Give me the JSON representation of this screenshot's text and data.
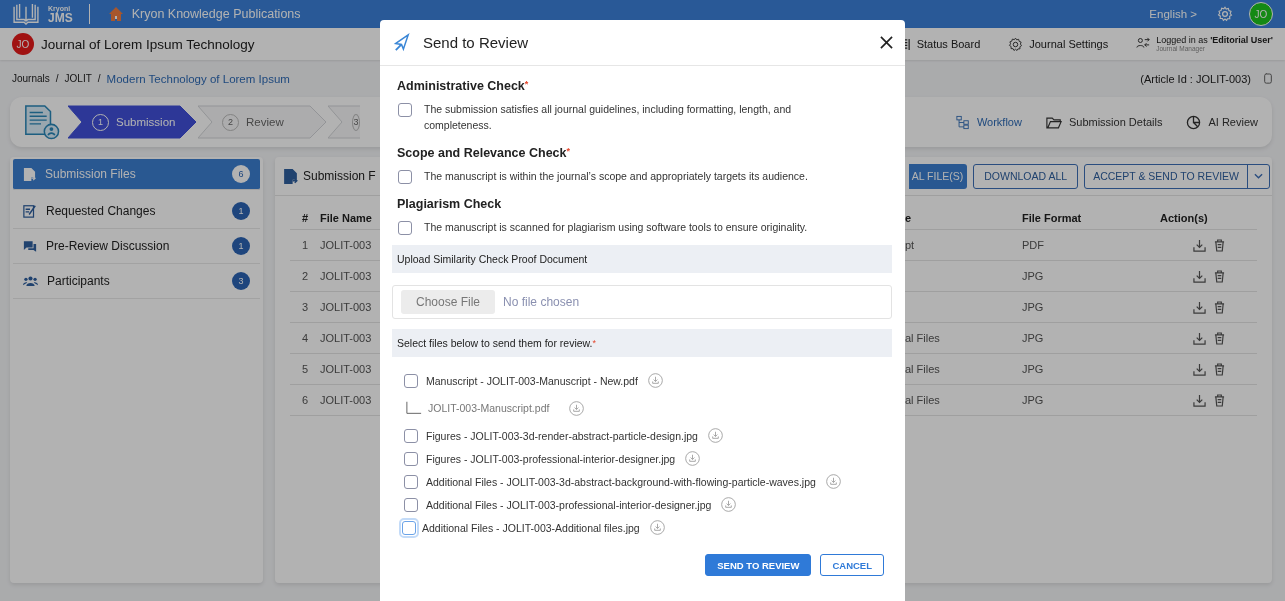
{
  "header": {
    "brand_small": "Kryoni",
    "brand": "JMS",
    "publisher": "Kryon Knowledge Publications",
    "language": "English >",
    "user_initials": "JO"
  },
  "journal_bar": {
    "initials": "JO",
    "journal": "Journal of Lorem Ipsum Technology",
    "links": [
      {
        "label": "Status Board",
        "kind": "board"
      },
      {
        "label": "Journal Settings",
        "kind": "settings"
      }
    ],
    "login": "Logged in as **'Editorial User'**",
    "role": "Journal Manager"
  },
  "breadcrumb": {
    "separator": "/",
    "items": [
      {
        "label": "Journals",
        "current": false
      },
      {
        "label": "JOLIT",
        "current": false
      },
      {
        "label": "Modern Technology of Lorem Ipsum",
        "current": true
      }
    ],
    "article_id": "(Article Id : JOLIT-003)"
  },
  "stepper": {
    "steps": [
      {
        "number": "1",
        "label": "Submission",
        "selected": true
      },
      {
        "number": "2",
        "label": "Review",
        "selected": false
      },
      {
        "number": "3",
        "selected": false
      }
    ],
    "tools": [
      {
        "label": "Workflow",
        "kind": "workflow",
        "selected": true
      },
      {
        "label": "Submission Details",
        "kind": "details",
        "selected": false
      },
      {
        "label": "AI Review",
        "kind": "ai",
        "selected": false
      }
    ]
  },
  "sidebar": {
    "items": [
      {
        "label": "Submission Files",
        "count": "6",
        "kind": "files",
        "selected": true
      },
      {
        "label": "Requested Changes",
        "count": "1",
        "kind": "changes",
        "selected": false
      },
      {
        "label": "Pre-Review Discussion",
        "count": "1",
        "kind": "discussion",
        "selected": false
      },
      {
        "label": "Participants",
        "count": "3",
        "kind": "participants",
        "selected": false
      }
    ]
  },
  "files_panel": {
    "title": "Submission F",
    "actions": [
      {
        "label": "AL FILE(S)",
        "kind": "primary"
      },
      {
        "label": "DOWNLOAD ALL",
        "kind": "outline"
      },
      {
        "label": "ACCEPT & SEND TO REVIEW",
        "kind": "split"
      }
    ],
    "table": {
      "columns": [
        "#",
        "File Name",
        "e",
        "File Format",
        "Action(s)"
      ],
      "rows": [
        {
          "number": "1",
          "file_name": "JOLIT-003",
          "column_3": "pt",
          "format": "PDF"
        },
        {
          "number": "2",
          "file_name": "JOLIT-003",
          "format": "JPG"
        },
        {
          "number": "3",
          "file_name": "JOLIT-003",
          "format": "JPG"
        },
        {
          "number": "4",
          "file_name": "JOLIT-003",
          "column_3": "al Files",
          "format": "JPG"
        },
        {
          "number": "5",
          "file_name": "JOLIT-003",
          "column_3": "al Files",
          "format": "JPG"
        },
        {
          "number": "6",
          "file_name": "JOLIT-003",
          "column_3": "al Files",
          "format": "JPG"
        }
      ]
    }
  },
  "modal": {
    "title": "Send to Review",
    "required_mark": "*",
    "checks": [
      {
        "title": "Administrative Check",
        "required": true,
        "items": [
          {
            "text": "The submission satisfies all journal guidelines, including formatting, length, and completeness.",
            "checked": false
          }
        ]
      },
      {
        "title": "Scope and Relevance Check",
        "required": true,
        "items": [
          {
            "text": "The manuscript is within the journal’s scope and appropriately targets its audience.",
            "checked": false
          }
        ]
      },
      {
        "title": "Plagiarism Check",
        "required": false,
        "items": [
          {
            "text": "The manuscript is scanned for plagiarism using software tools to ensure originality.",
            "checked": false
          }
        ]
      }
    ],
    "upload": {
      "label": "Upload Similarity Check Proof Document",
      "button": "Choose File",
      "status": "No file chosen"
    },
    "files": {
      "label": "Select files below to send them for review.",
      "required": true,
      "items": [
        {
          "label": "Manuscript - JOLIT-003-Manuscript - New.pdf",
          "checked": false,
          "focused": false,
          "children": [
            {
              "label": "JOLIT-003-Manuscript.pdf"
            }
          ]
        },
        {
          "label": "Figures - JOLIT-003-3d-render-abstract-particle-design.jpg",
          "checked": false,
          "focused": false
        },
        {
          "label": "Figures - JOLIT-003-professional-interior-designer.jpg",
          "checked": false,
          "focused": false
        },
        {
          "label": "Additional Files - JOLIT-003-3d-abstract-background-with-flowing-particle-waves.jpg",
          "checked": false,
          "focused": false
        },
        {
          "label": "Additional Files - JOLIT-003-professional-interior-designer.jpg",
          "checked": false,
          "focused": false
        },
        {
          "label": "Additional Files - JOLIT-003-Additional files.jpg",
          "checked": false,
          "focused": true
        }
      ]
    },
    "buttons": [
      {
        "label": "SEND TO REVIEW",
        "kind": "primary"
      },
      {
        "label": "CANCEL",
        "kind": "outline"
      }
    ]
  }
}
